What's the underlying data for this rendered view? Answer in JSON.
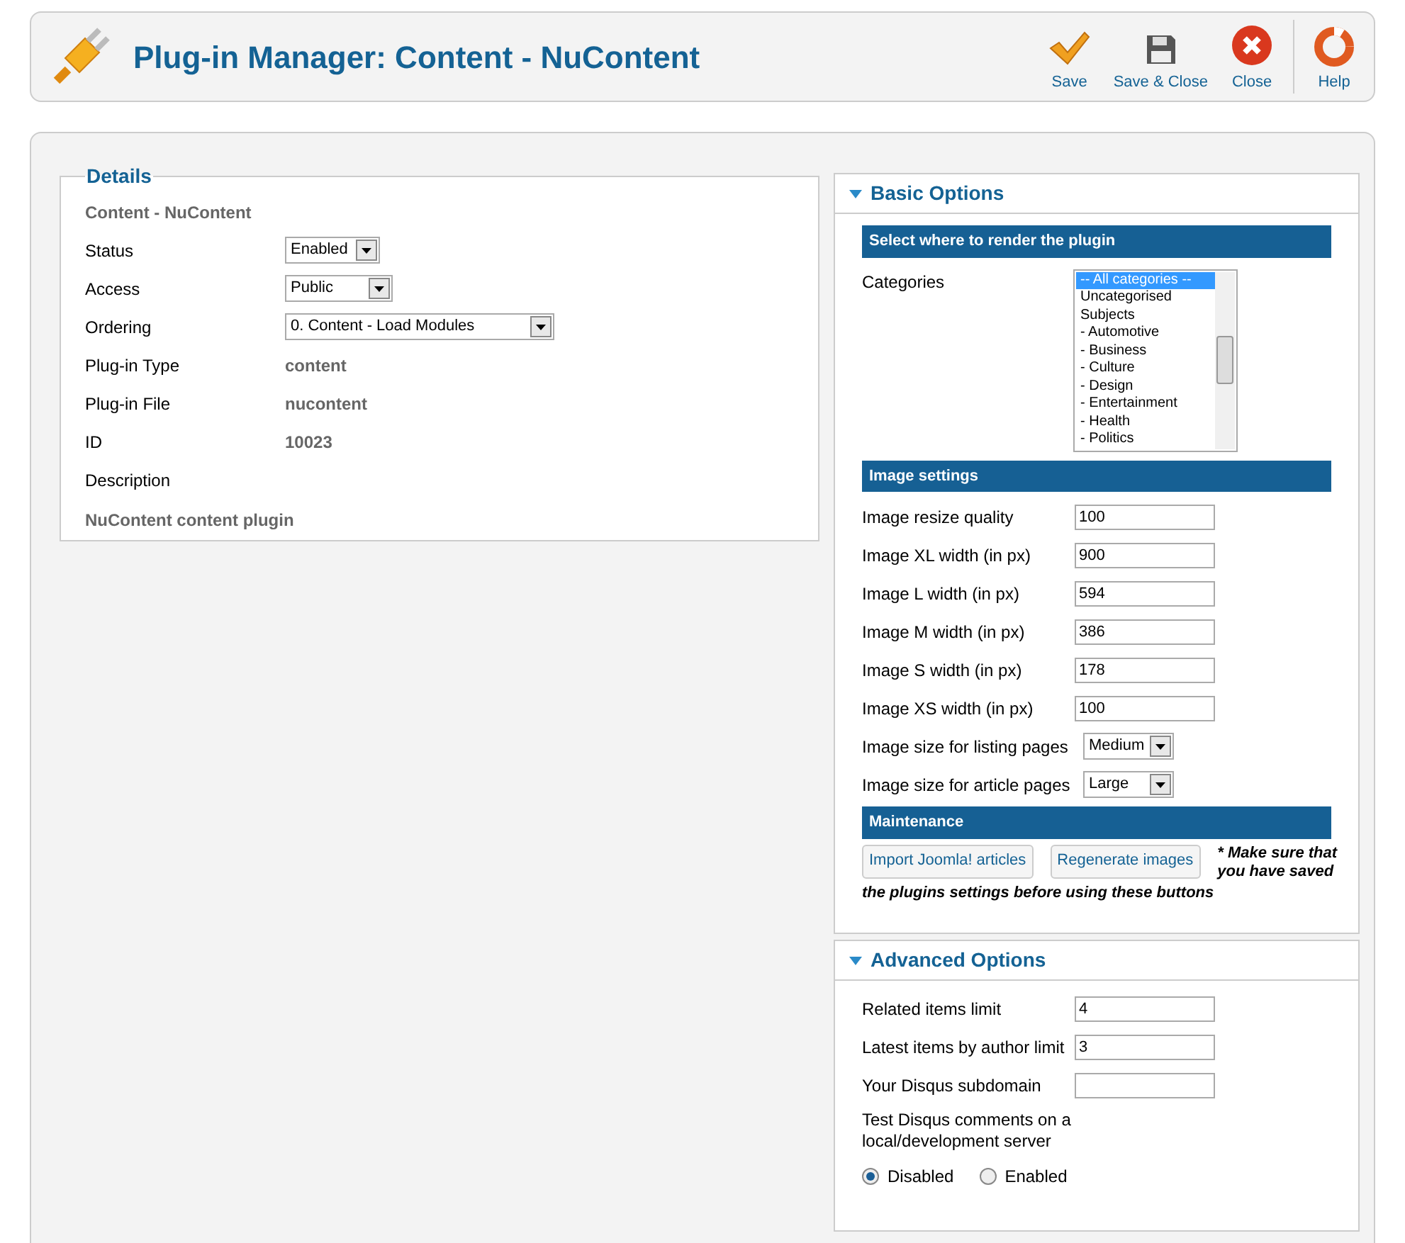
{
  "header": {
    "title": "Plug-in Manager: Content - NuContent"
  },
  "toolbar": [
    {
      "kind": "save",
      "label": "Save"
    },
    {
      "kind": "save-close",
      "label": "Save & Close"
    },
    {
      "kind": "close",
      "label": "Close"
    },
    {
      "kind": "help",
      "label": "Help"
    }
  ],
  "details": {
    "legend": "Details",
    "subtitle": "Content - NuContent",
    "rows": [
      {
        "kind": "select",
        "label": "Status",
        "value": "Enabled"
      },
      {
        "kind": "select",
        "label": "Access",
        "value": "Public"
      },
      {
        "kind": "select",
        "label": "Ordering",
        "value": "0. Content - Load Modules"
      },
      {
        "kind": "value",
        "label": "Plug-in Type",
        "value": "content"
      },
      {
        "kind": "value",
        "label": "Plug-in File",
        "value": "nucontent"
      },
      {
        "kind": "value",
        "label": "ID",
        "value": "10023"
      },
      {
        "kind": "label",
        "label": "Description"
      }
    ],
    "description": "NuContent content plugin"
  },
  "basic_options": {
    "title": "Basic Options",
    "expanded": true,
    "render_heading": "Select where to render the plugin",
    "categories": {
      "label": "Categories",
      "items": [
        {
          "label": "-- All categories --",
          "selected": true
        },
        {
          "label": "Uncategorised",
          "selected": false
        },
        {
          "label": "Subjects",
          "selected": false
        },
        {
          "label": "- Automotive",
          "selected": false
        },
        {
          "label": "- Business",
          "selected": false
        },
        {
          "label": "- Culture",
          "selected": false
        },
        {
          "label": "- Design",
          "selected": false
        },
        {
          "label": "- Entertainment",
          "selected": false
        },
        {
          "label": "- Health",
          "selected": false
        },
        {
          "label": "- Politics",
          "selected": false
        }
      ]
    },
    "image_heading": "Image settings",
    "image_fields": [
      {
        "kind": "input",
        "label": "Image resize quality",
        "value": "100"
      },
      {
        "kind": "input",
        "label": "Image XL width (in px)",
        "value": "900"
      },
      {
        "kind": "input",
        "label": "Image L width (in px)",
        "value": "594"
      },
      {
        "kind": "input",
        "label": "Image M width (in px)",
        "value": "386"
      },
      {
        "kind": "input",
        "label": "Image S width (in px)",
        "value": "178"
      },
      {
        "kind": "input",
        "label": "Image XS width (in px)",
        "value": "100"
      },
      {
        "kind": "select",
        "label": "Image size for listing pages",
        "value": "Medium"
      },
      {
        "kind": "select",
        "label": "Image size for article pages",
        "value": "Large"
      }
    ],
    "maintenance_heading": "Maintenance",
    "buttons": [
      "Import Joomla! articles",
      "Regenerate images"
    ],
    "note_lines": [
      "* Make sure that",
      "you have saved"
    ],
    "note_tail": "the plugins settings before using these buttons"
  },
  "advanced_options": {
    "title": "Advanced Options",
    "expanded": true,
    "fields": [
      {
        "label": "Related items limit",
        "value": "4"
      },
      {
        "label": "Latest items by author limit",
        "value": "3"
      },
      {
        "label": "Your Disqus subdomain"
      }
    ],
    "radio_label": "Test Disqus comments on a local/development server",
    "radios": [
      {
        "label": "Disabled",
        "selected": true
      },
      {
        "label": "Enabled",
        "selected": false
      }
    ]
  }
}
